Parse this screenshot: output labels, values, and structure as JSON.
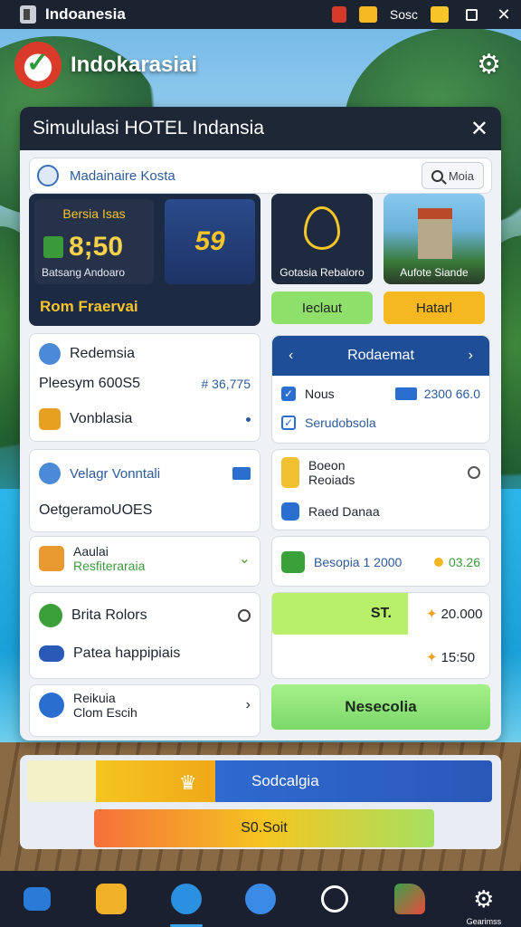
{
  "system_bar": {
    "title": "Indoanesia",
    "tray_text": "Sosc"
  },
  "brand": {
    "name": "Indokarasiai"
  },
  "panel": {
    "title": "Simululasi HOTEL Indansia",
    "search_text": "Madainaire Kosta",
    "search_button": "Moia",
    "stat": {
      "label": "Bersia Isas",
      "value": "8;50",
      "sub": "Batsang Andoaro",
      "badge": "59",
      "footer": "Rom Fraervai"
    },
    "icon_cards": [
      {
        "caption": "Gotasia Rebaloro",
        "button": "Ieclaut"
      },
      {
        "caption": "Aufote Siande",
        "button": "Hatarl"
      }
    ],
    "left_cards": {
      "c1": {
        "title": "Redemsia",
        "row2": "Pleesym 600S5",
        "row2_val": "# 36,775",
        "row3": "Vonblasia"
      },
      "c2": {
        "title": "Velagr Vonntali",
        "row2": "OetgeramoUOES"
      },
      "c3": {
        "line1": "Aaulai",
        "line2": "Resfiteraraia"
      },
      "c4": {
        "row1": "Brita Rolors",
        "row2": "Patea happipiais"
      },
      "c5": {
        "line1": "Reikuia",
        "line2": "Clom Escih"
      }
    },
    "right_cards": {
      "nav": {
        "title": "Rodaemat",
        "row1": "Nous",
        "row1_val": "2300 66.0",
        "row2": "Serudobsola"
      },
      "c2": {
        "line1": "Boeon",
        "line2": "Reoiads",
        "line3": "Raed Danaa"
      },
      "c3": {
        "label": "Besopia 1 2000",
        "value": "03.26"
      },
      "c4": {
        "bar_label": "ST.",
        "value1": "20.000",
        "value2": "15:50"
      },
      "button": "Nesecolia"
    }
  },
  "bottom_panel": {
    "banner": "Sodcalgia",
    "action": "S0.Soit"
  },
  "taskbar": {
    "items": [
      {
        "icon": "home-icon"
      },
      {
        "icon": "hotel-icon"
      },
      {
        "icon": "globe-icon"
      },
      {
        "icon": "chat-icon"
      },
      {
        "icon": "web-icon"
      },
      {
        "icon": "map-icon"
      },
      {
        "icon": "settings-icon",
        "label": "Gearimss"
      }
    ]
  },
  "colors": {
    "panel_header": "#1e2735",
    "accent_blue": "#1f4e98",
    "accent_gold": "#f5c52a",
    "accent_green": "#8ee06a"
  }
}
